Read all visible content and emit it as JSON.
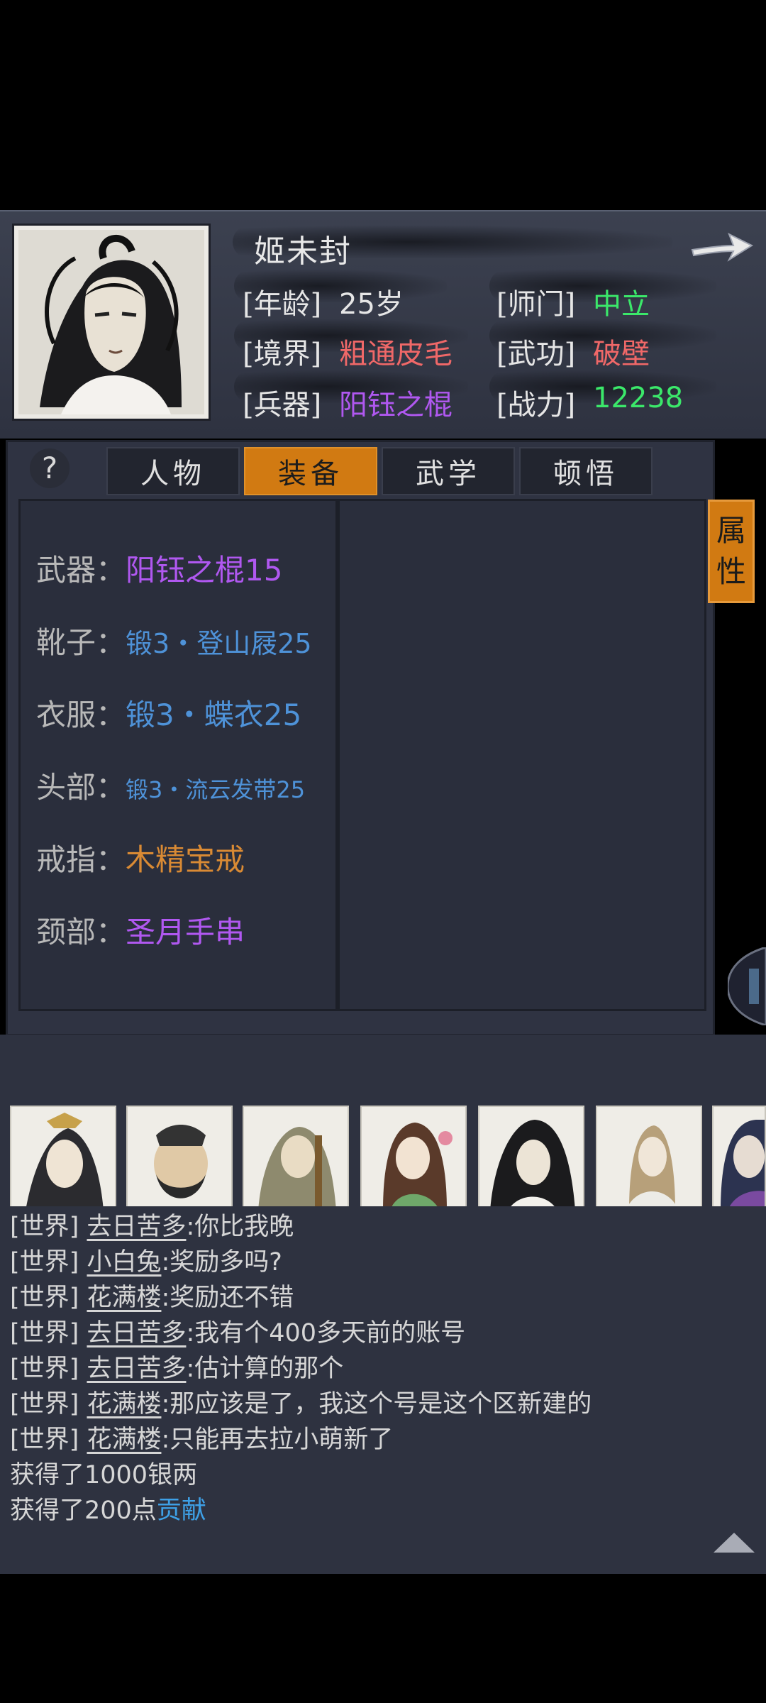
{
  "profile": {
    "name": "姬未封",
    "stats": [
      {
        "label": "[年龄]",
        "value": "25岁",
        "color": "#e6e6e6"
      },
      {
        "label": "[师门]",
        "value": "中立",
        "color": "#3be86a"
      },
      {
        "label": "[境界]",
        "value": "粗通皮毛",
        "color": "#f06868"
      },
      {
        "label": "[武功]",
        "value": "破壁",
        "color": "#f06868"
      },
      {
        "label": "[兵器]",
        "value": "阳钰之棍",
        "color": "#b058f0"
      },
      {
        "label": "[战力]",
        "value": "12238",
        "color": "#3be86a"
      }
    ]
  },
  "tabs": [
    {
      "label": "人物",
      "active": false
    },
    {
      "label": "装备",
      "active": true
    },
    {
      "label": "武学",
      "active": false
    },
    {
      "label": "顿悟",
      "active": false
    }
  ],
  "equipment": [
    {
      "label": "武器：",
      "value": "阳钰之棍15",
      "color": "#b058f0"
    },
    {
      "label": "靴子：",
      "value": "锻3・登山屐25",
      "color": "#4e92d8"
    },
    {
      "label": "衣服：",
      "value": "锻3・蝶衣25",
      "color": "#4e92d8"
    },
    {
      "label": "头部：",
      "value": "锻3・流云发带25",
      "color": "#4e92d8"
    },
    {
      "label": "戒指：",
      "value": "木精宝戒",
      "color": "#d98a34"
    },
    {
      "label": "颈部：",
      "value": "圣月手串",
      "color": "#b058f0"
    }
  ],
  "attr_tab": {
    "line1": "属",
    "line2": "性"
  },
  "chat": [
    {
      "channel": "[世界]",
      "user": "去日苦多",
      "text": ":你比我晚"
    },
    {
      "channel": "[世界]",
      "user": "小白兔",
      "text": ":奖励多吗?"
    },
    {
      "channel": "[世界]",
      "user": "花满楼",
      "text": ":奖励还不错"
    },
    {
      "channel": "[世界]",
      "user": "去日苦多",
      "text": ":我有个400多天前的账号"
    },
    {
      "channel": "[世界]",
      "user": "去日苦多",
      "text": ":估计算的那个"
    },
    {
      "channel": "[世界]",
      "user": "花满楼",
      "text": ":那应该是了，我这个号是这个区新建的"
    },
    {
      "channel": "[世界]",
      "user": "花满楼",
      "text": ":只能再去拉小萌新了"
    }
  ],
  "system_msgs": [
    {
      "text": "获得了1000银两",
      "highlight": ""
    },
    {
      "text": "获得了200点",
      "highlight": "贡献"
    }
  ]
}
